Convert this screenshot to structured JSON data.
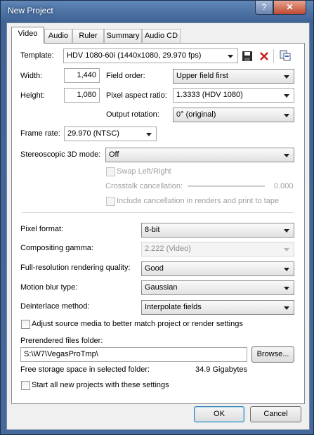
{
  "window": {
    "title": "New Project",
    "help_label": "?",
    "close_label": "✕"
  },
  "tabs": [
    "Video",
    "Audio",
    "Ruler",
    "Summary",
    "Audio CD"
  ],
  "template": {
    "label": "Template:",
    "value": "HDV 1080-60i (1440x1080, 29.970 fps)"
  },
  "width": {
    "label": "Width:",
    "value": "1,440"
  },
  "height": {
    "label": "Height:",
    "value": "1,080"
  },
  "field_order": {
    "label": "Field order:",
    "value": "Upper field first"
  },
  "pixel_aspect": {
    "label": "Pixel aspect ratio:",
    "value": "1.3333 (HDV 1080)"
  },
  "output_rotation": {
    "label": "Output rotation:",
    "value": "0° (original)"
  },
  "frame_rate": {
    "label": "Frame rate:",
    "value": "29.970 (NTSC)"
  },
  "stereo": {
    "label": "Stereoscopic 3D mode:",
    "value": "Off"
  },
  "swap": {
    "label": "Swap Left/Right"
  },
  "crosstalk": {
    "label": "Crosstalk cancellation:",
    "value": "0.000"
  },
  "include_cancel": {
    "label": "Include cancellation in renders and print to tape"
  },
  "pixel_format": {
    "label": "Pixel format:",
    "value": "8-bit"
  },
  "compositing_gamma": {
    "label": "Compositing gamma:",
    "value": "2.222 (Video)"
  },
  "full_res": {
    "label": "Full-resolution rendering quality:",
    "value": "Good"
  },
  "motion_blur": {
    "label": "Motion blur type:",
    "value": "Gaussian"
  },
  "deinterlace": {
    "label": "Deinterlace method:",
    "value": "Interpolate fields"
  },
  "adjust_source": {
    "label": "Adjust source media to better match project or render settings"
  },
  "prerendered": {
    "label": "Prerendered files folder:",
    "value": "S:\\W7\\VegasProTmp\\",
    "browse_label": "Browse..."
  },
  "free_storage": {
    "label": "Free storage space in selected folder:",
    "value": "34.9 Gigabytes"
  },
  "start_all": {
    "label": "Start all new projects with these settings"
  },
  "buttons": {
    "ok": "OK",
    "cancel": "Cancel"
  },
  "icons": {
    "save": "save-icon",
    "delete": "delete-icon",
    "match": "match-media-icon"
  }
}
